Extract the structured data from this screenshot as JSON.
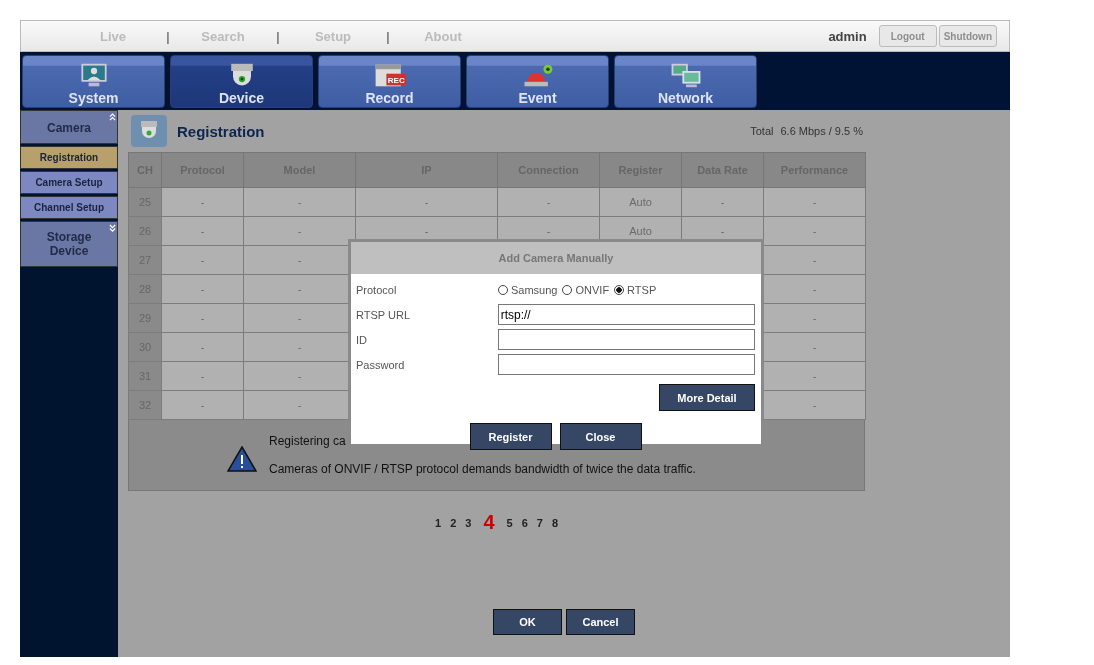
{
  "top_nav": {
    "links": [
      {
        "label": "Live",
        "selected": false
      },
      {
        "label": "Search",
        "selected": false
      },
      {
        "label": "Setup",
        "selected": false
      },
      {
        "label": "About",
        "selected": false
      }
    ],
    "separator": "|",
    "user": "admin",
    "buttons": [
      {
        "label": "Logout",
        "disabled": true
      },
      {
        "label": "Shutdown",
        "disabled": true
      }
    ]
  },
  "main_tabs": [
    {
      "kind": "system",
      "label": "System",
      "selected": false
    },
    {
      "kind": "device",
      "label": "Device",
      "selected": true
    },
    {
      "kind": "record",
      "label": "Record",
      "badge": "REC",
      "selected": false
    },
    {
      "kind": "event",
      "label": "Event",
      "selected": false
    },
    {
      "kind": "network",
      "label": "Network",
      "selected": false
    }
  ],
  "sidebar": [
    {
      "label": "Camera",
      "expanded": true,
      "children": [
        {
          "label": "Registration",
          "selected": true
        },
        {
          "label": "Camera Setup",
          "selected": false
        },
        {
          "label": "Channel Setup",
          "selected": false
        }
      ]
    },
    {
      "label": "Storage Device",
      "expanded": false
    }
  ],
  "page": {
    "title": "Registration",
    "total_label": "Total",
    "total_value": "6.6 Mbps / 9.5 %"
  },
  "table": {
    "columns": [
      "CH",
      "Protocol",
      "Model",
      "IP",
      "Connection",
      "Register",
      "Data Rate",
      "Performance"
    ],
    "rows": [
      [
        "25",
        "-",
        "-",
        "-",
        "-",
        "Auto",
        "-",
        "-"
      ],
      [
        "26",
        "-",
        "-",
        "-",
        "-",
        "Auto",
        "-",
        "-"
      ],
      [
        "27",
        "-",
        "-",
        null,
        null,
        null,
        null,
        "-"
      ],
      [
        "28",
        "-",
        "-",
        null,
        null,
        null,
        null,
        "-"
      ],
      [
        "29",
        "-",
        "-",
        null,
        null,
        null,
        null,
        "-"
      ],
      [
        "30",
        "-",
        "-",
        null,
        null,
        null,
        null,
        "-"
      ],
      [
        "31",
        "-",
        "-",
        null,
        null,
        null,
        null,
        "-"
      ],
      [
        "32",
        "-",
        "-",
        null,
        null,
        null,
        null,
        "-"
      ]
    ]
  },
  "notice": {
    "lines": [
      "Registering ca",
      "Cameras of ONVIF / RTSP protocol demands bandwidth of twice the data traffic."
    ]
  },
  "pagination": [
    {
      "label": "1",
      "selected": false
    },
    {
      "label": "2",
      "selected": false
    },
    {
      "label": "3",
      "selected": false
    },
    {
      "label": "4",
      "selected": true
    },
    {
      "label": "5",
      "selected": false
    },
    {
      "label": "6",
      "selected": false
    },
    {
      "label": "7",
      "selected": false
    },
    {
      "label": "8",
      "selected": false
    }
  ],
  "footer_buttons": [
    "OK",
    "Cancel"
  ],
  "dialog": {
    "title": "Add Camera Manually",
    "protocol_label": "Protocol",
    "protocols": [
      {
        "label": "Samsung",
        "selected": false
      },
      {
        "label": "ONVIF",
        "selected": false
      },
      {
        "label": "RTSP",
        "selected": true
      }
    ],
    "fields": [
      {
        "label": "RTSP URL",
        "value": "rtsp://"
      },
      {
        "label": "ID"
      },
      {
        "label": "Password"
      }
    ],
    "detail_button": "More Detail",
    "buttons": [
      "Register",
      "Close"
    ]
  }
}
